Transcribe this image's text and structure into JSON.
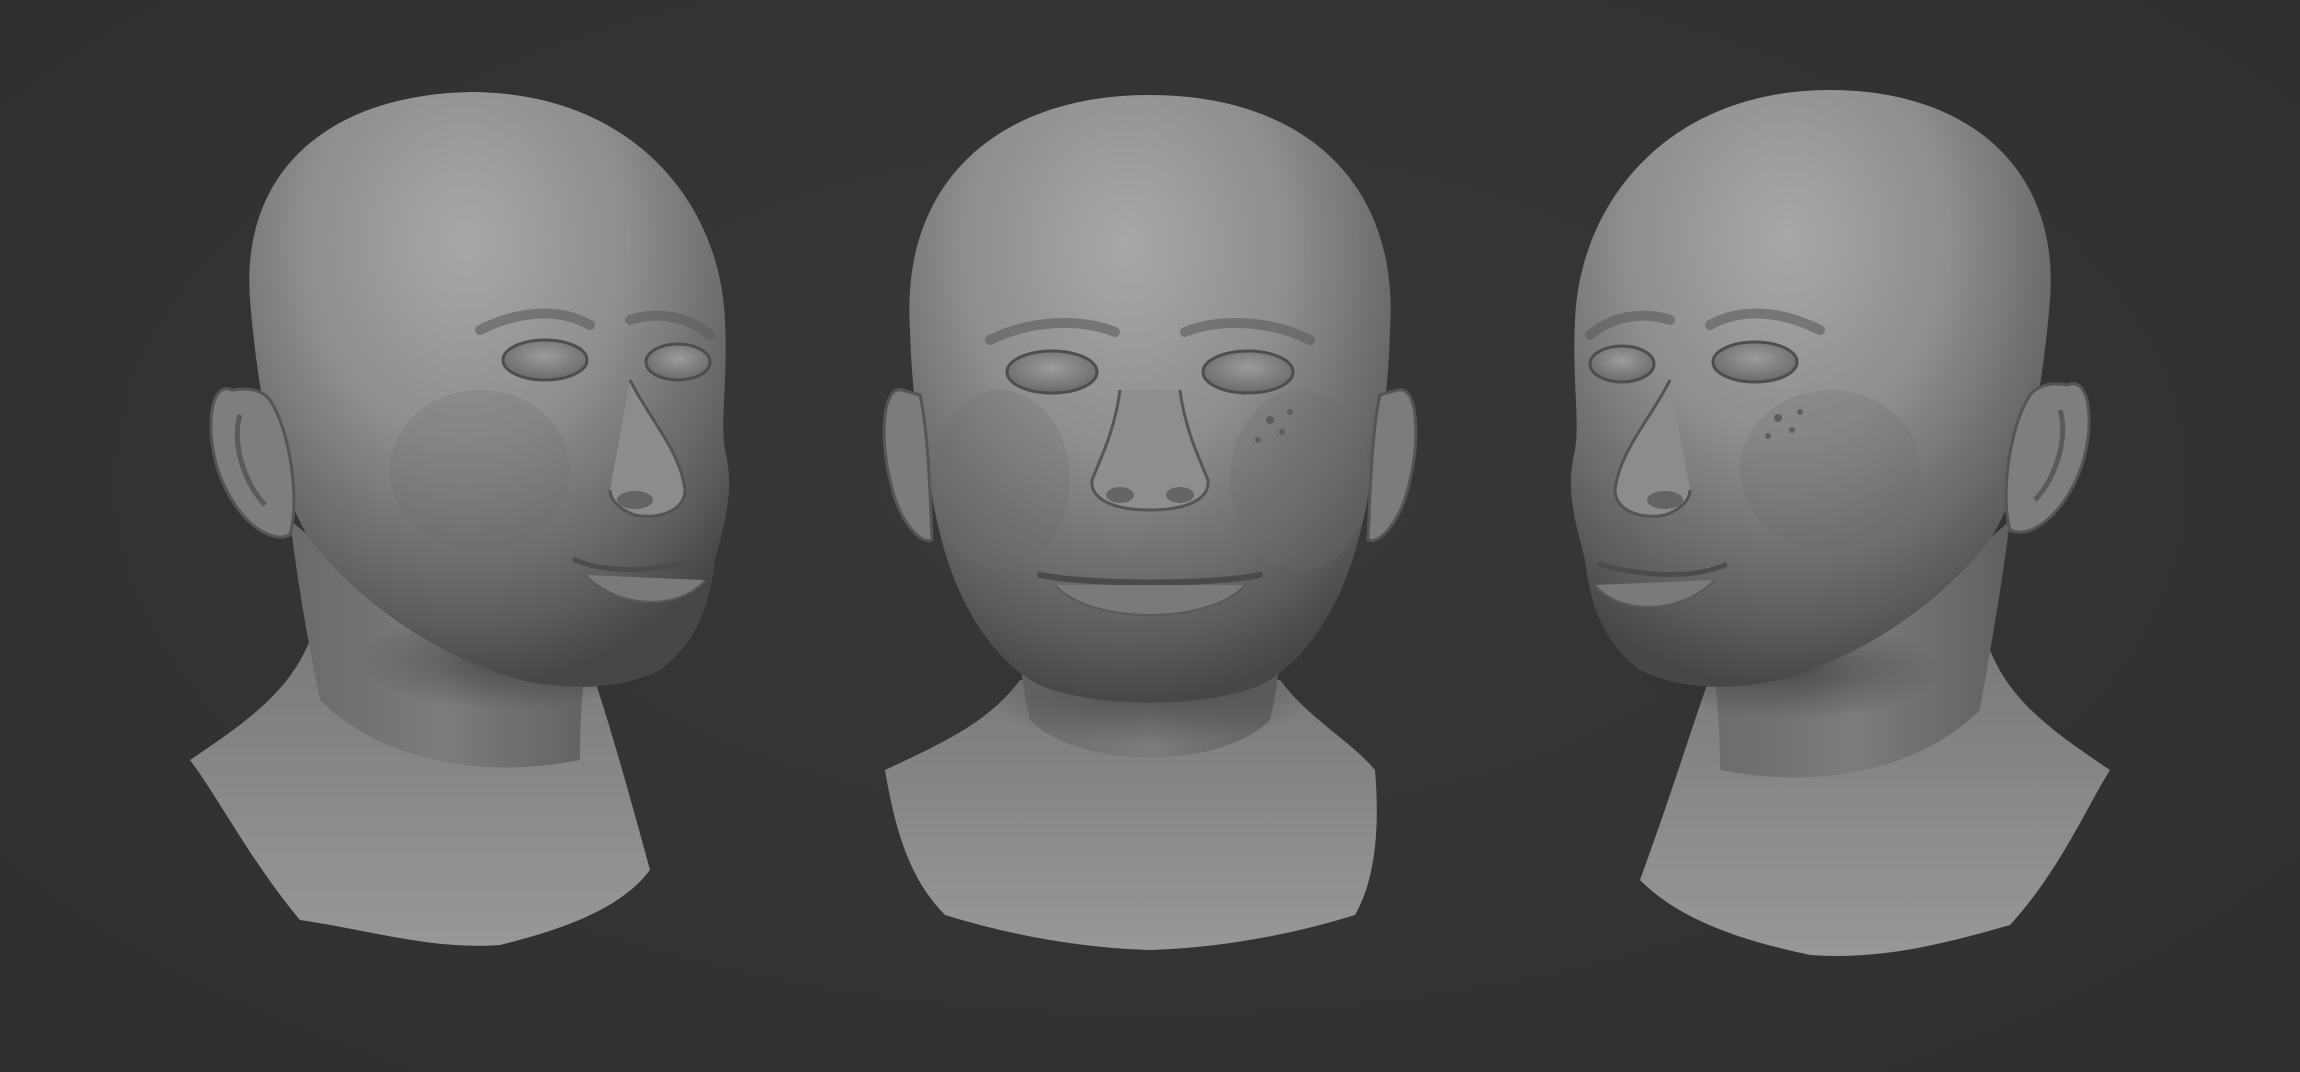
{
  "scene": {
    "background_color": "#333333",
    "material_color": "#8a8a8a",
    "views": [
      {
        "id": "three-quarter-right",
        "icon": "sculpted-head-bust"
      },
      {
        "id": "front",
        "icon": "sculpted-head-bust"
      },
      {
        "id": "three-quarter-left",
        "icon": "sculpted-head-bust"
      }
    ]
  }
}
